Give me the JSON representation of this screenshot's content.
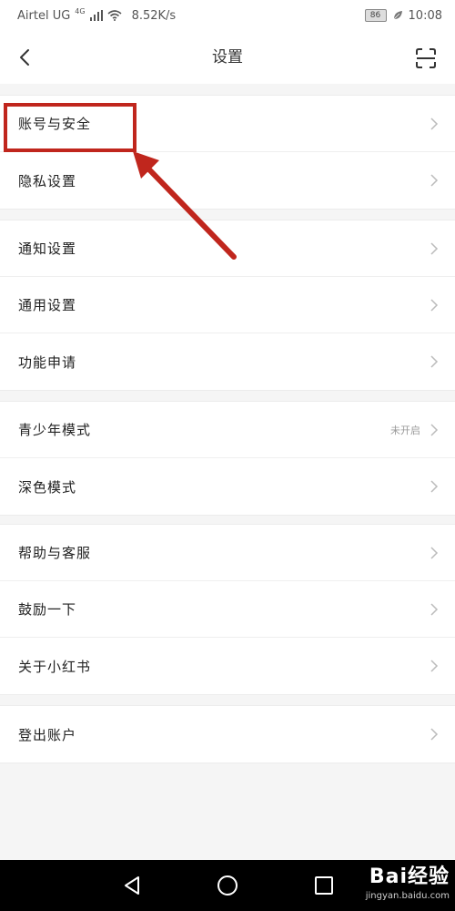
{
  "status_bar": {
    "carrier": "Airtel UG",
    "network": "4G",
    "speed": "8.52K/s",
    "battery": "86",
    "time": "10:08"
  },
  "header": {
    "title": "设置"
  },
  "groups": [
    {
      "items": [
        {
          "label": "账号与安全"
        },
        {
          "label": "隐私设置"
        }
      ]
    },
    {
      "items": [
        {
          "label": "通知设置"
        },
        {
          "label": "通用设置"
        },
        {
          "label": "功能申请"
        }
      ]
    },
    {
      "items": [
        {
          "label": "青少年模式",
          "value": "未开启"
        },
        {
          "label": "深色模式"
        }
      ]
    },
    {
      "items": [
        {
          "label": "帮助与客服"
        },
        {
          "label": "鼓励一下"
        },
        {
          "label": "关于小红书"
        }
      ]
    },
    {
      "items": [
        {
          "label": "登出账户"
        }
      ]
    }
  ],
  "watermark": {
    "brand": "Bai经验",
    "site": "jingyan.baidu.com"
  },
  "colors": {
    "annotation": "#c0261d",
    "background": "#f5f5f5",
    "nav_bar": "#000000"
  }
}
